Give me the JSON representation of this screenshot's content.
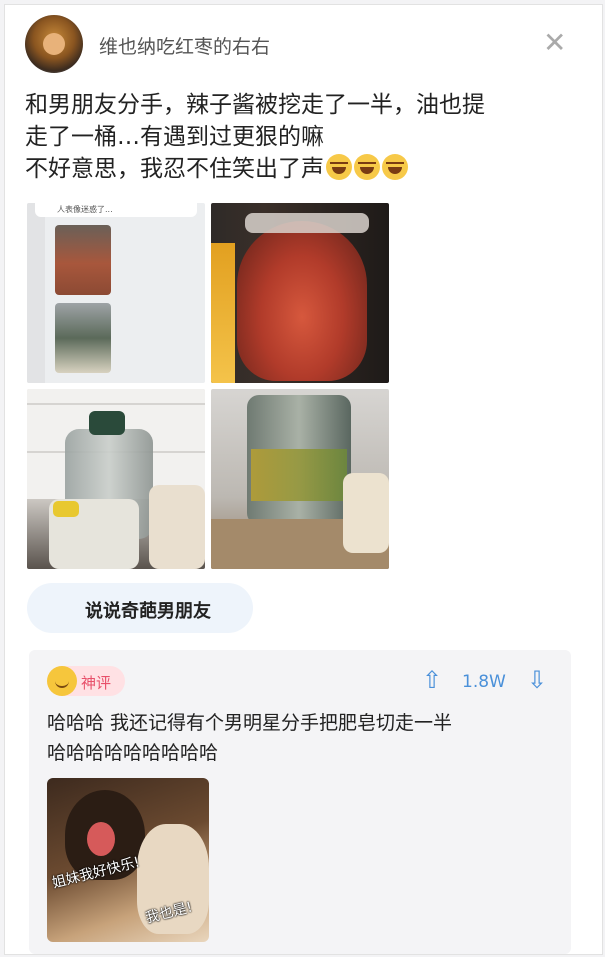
{
  "post": {
    "username": "维也纳吃红枣的右右",
    "close_icon": "close-icon",
    "text_lines": [
      "和男朋友分手，辣子酱被挖走了一半，油也提",
      "走了一桶…有遇到过更狠的嘛",
      "不好意思，我忍不住笑出了声"
    ],
    "emoji_name": "laughing-tears-emoji",
    "image_thumb_caption": "人表像迷惑了...",
    "topic": "说说奇葩男朋友"
  },
  "comment": {
    "badge": "神评",
    "upvotes": "1.8W",
    "up_icon": "arrow-up-icon",
    "down_icon": "arrow-down-icon",
    "text_lines": [
      "哈哈哈  我还记得有个男明星分手把肥皂切走一半",
      "哈哈哈哈哈哈哈哈哈"
    ],
    "meme_caption_1": "姐妹我好快乐!",
    "meme_caption_2": "我也是!"
  },
  "colors": {
    "accent_blue": "#4a90d9",
    "badge_pink": "#e8506a"
  }
}
